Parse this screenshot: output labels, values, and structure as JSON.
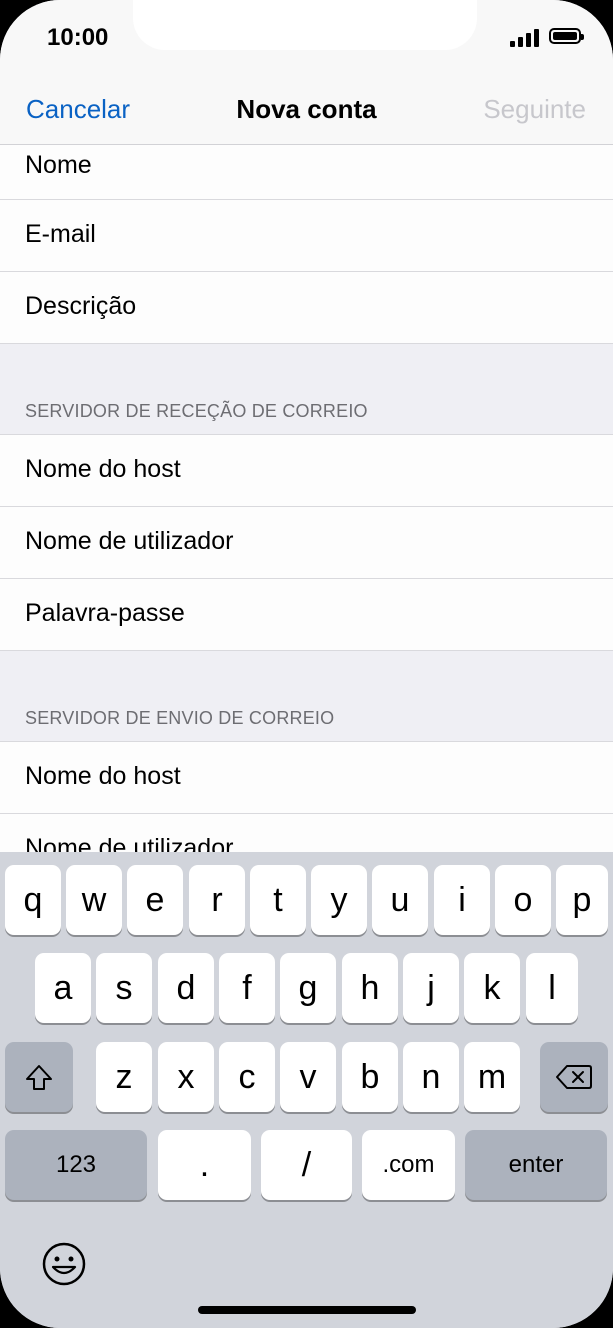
{
  "status_bar": {
    "time": "10:00"
  },
  "nav": {
    "cancel": "Cancelar",
    "title": "Nova conta",
    "next": "Seguinte"
  },
  "account_fields": [
    "Nome",
    "E-mail",
    "Descrição"
  ],
  "incoming": {
    "header": "SERVIDOR DE RECEÇÃO DE CORREIO",
    "fields": [
      "Nome do host",
      "Nome de utilizador",
      "Palavra-passe"
    ]
  },
  "outgoing": {
    "header": "SERVIDOR DE ENVIO DE CORREIO",
    "fields": [
      "Nome do host",
      "Nome de utilizador"
    ]
  },
  "keyboard": {
    "row1": [
      "q",
      "w",
      "e",
      "r",
      "t",
      "y",
      "u",
      "i",
      "o",
      "p"
    ],
    "row2": [
      "a",
      "s",
      "d",
      "f",
      "g",
      "h",
      "j",
      "k",
      "l"
    ],
    "row3": [
      "z",
      "x",
      "c",
      "v",
      "b",
      "n",
      "m"
    ],
    "key_123": "123",
    "key_dot": ".",
    "key_slash": "/",
    "key_com": ".com",
    "key_enter": "enter",
    "icons": {
      "shift": "shift-icon",
      "delete": "delete-icon",
      "emoji": "emoji-icon"
    }
  },
  "colors": {
    "link": "#0a62c4",
    "disabled": "#c7c7cc",
    "section_header": "#6d6d72"
  }
}
